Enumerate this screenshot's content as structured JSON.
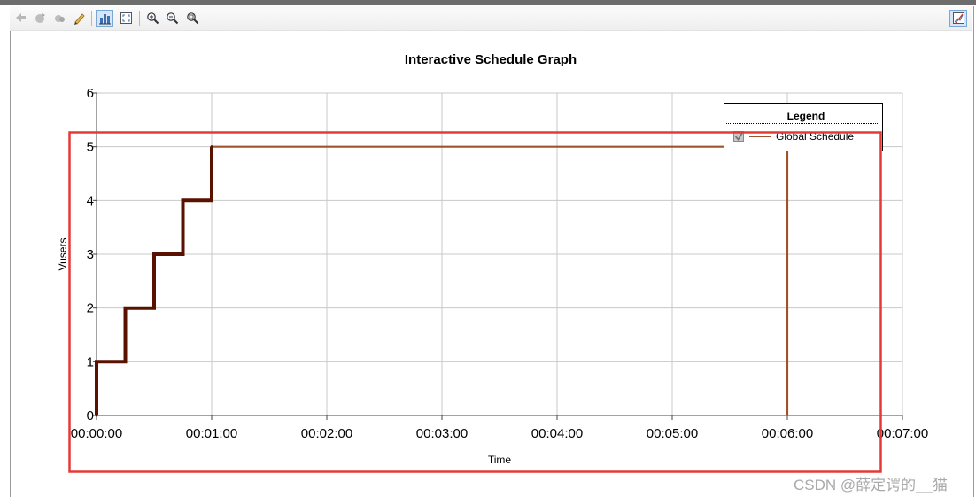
{
  "toolbar": {
    "buttons": [
      {
        "icon": "back-icon",
        "active": false
      },
      {
        "icon": "forward-icon",
        "active": false
      },
      {
        "icon": "refresh-icon",
        "active": false
      },
      {
        "icon": "pencil-icon",
        "active": false
      },
      {
        "icon": "bar-chart-icon",
        "active": true
      },
      {
        "icon": "fit-window-icon",
        "active": false
      },
      {
        "icon": "zoom-in-icon",
        "active": false
      },
      {
        "icon": "zoom-out-icon",
        "active": false
      },
      {
        "icon": "zoom-reset-icon",
        "active": false
      }
    ],
    "right_button": {
      "icon": "edit-graph-icon",
      "active": true
    }
  },
  "chart_data": {
    "type": "line",
    "title": "Interactive Schedule Graph",
    "xlabel": "Time",
    "ylabel": "Vusers",
    "x_ticks": [
      "00:00:00",
      "00:01:00",
      "00:02:00",
      "00:03:00",
      "00:04:00",
      "00:05:00",
      "00:06:00",
      "00:07:00"
    ],
    "y_ticks": [
      "0",
      "1",
      "2",
      "3",
      "4",
      "5",
      "6"
    ],
    "xlim": [
      "00:00:00",
      "00:07:00"
    ],
    "ylim": [
      0,
      6
    ],
    "grid": true,
    "legend": {
      "title": "Legend",
      "position": "top-right",
      "checked": true
    },
    "series": [
      {
        "name": "Global Schedule",
        "color": "#a0522d",
        "ramp_color": "#5a1200",
        "points": [
          [
            "00:00:00",
            0
          ],
          [
            "00:00:00",
            1
          ],
          [
            "00:00:15",
            1
          ],
          [
            "00:00:15",
            2
          ],
          [
            "00:00:30",
            2
          ],
          [
            "00:00:30",
            3
          ],
          [
            "00:00:45",
            3
          ],
          [
            "00:00:45",
            4
          ],
          [
            "00:01:00",
            4
          ],
          [
            "00:01:00",
            5
          ],
          [
            "00:06:00",
            5
          ],
          [
            "00:06:00",
            0
          ]
        ]
      }
    ],
    "highlight_color": "#e53935"
  },
  "watermark": "CSDN @薛定谔的__猫"
}
